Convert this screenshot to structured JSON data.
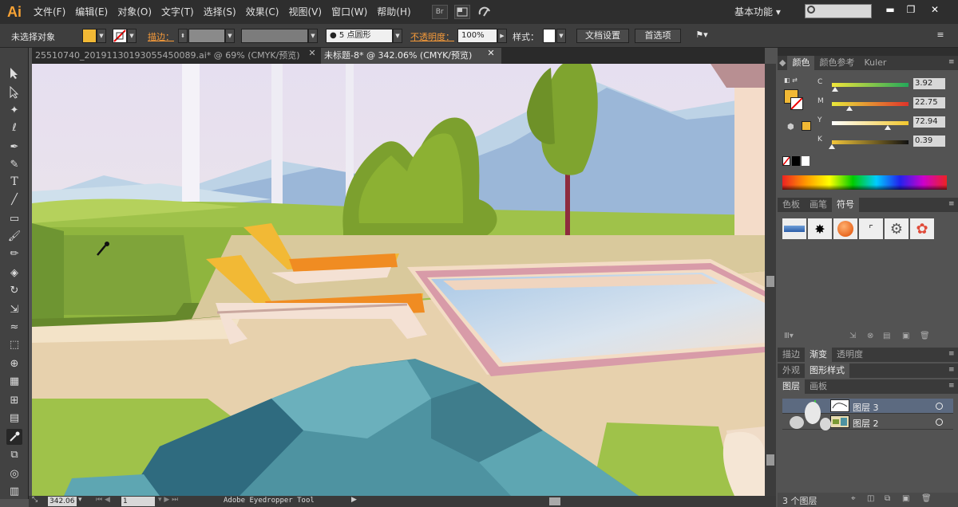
{
  "app": {
    "logo": "Ai"
  },
  "menu": [
    "文件(F)",
    "编辑(E)",
    "对象(O)",
    "文字(T)",
    "选择(S)",
    "效果(C)",
    "视图(V)",
    "窗口(W)",
    "帮助(H)"
  ],
  "menubar": {
    "bridge_label": "Br",
    "workspace": "基本功能 ▾"
  },
  "window_controls": {
    "minimize": "▬",
    "restore": "❐",
    "close": "✕"
  },
  "control_bar": {
    "selection": "未选择对象",
    "stroke_label": "描边：",
    "brush": "5 点圆形",
    "opacity_label": "不透明度：",
    "opacity_value": "100%",
    "style_label": "样式：",
    "doc_setup": "文档设置",
    "preferences": "首选项",
    "fill_color": "#f2b935"
  },
  "tabs": [
    {
      "label": "25510740_20191130193055450089.ai* @ 69% (CMYK/预览)"
    },
    {
      "label": "未标题-8* @ 342.06% (CMYK/预览)"
    }
  ],
  "status": {
    "zoom": "342.06",
    "artboard": "1",
    "tool": "Adobe Eyedropper Tool"
  },
  "color_panel": {
    "tabs": [
      "颜色",
      "颜色参考",
      "Kuler"
    ],
    "channels": [
      {
        "label": "C",
        "value": "3.92",
        "pct": 3.92
      },
      {
        "label": "M",
        "value": "22.75",
        "pct": 22.75
      },
      {
        "label": "Y",
        "value": "72.94",
        "pct": 72.94
      },
      {
        "label": "K",
        "value": "0.39",
        "pct": 0.39
      }
    ],
    "fill": "#f2b935"
  },
  "swatch_panel": {
    "tabs": [
      "色板",
      "画笔",
      "符号"
    ]
  },
  "stroke_panel": {
    "tabs": [
      "描边",
      "渐变",
      "透明度"
    ]
  },
  "appearance_panel": {
    "tabs": [
      "外观",
      "图形样式"
    ]
  },
  "layers_panel": {
    "tabs": [
      "图层",
      "画板"
    ],
    "layers": [
      {
        "name": "图层 3"
      },
      {
        "name": "图层 2"
      }
    ],
    "count": "3 个图层"
  }
}
